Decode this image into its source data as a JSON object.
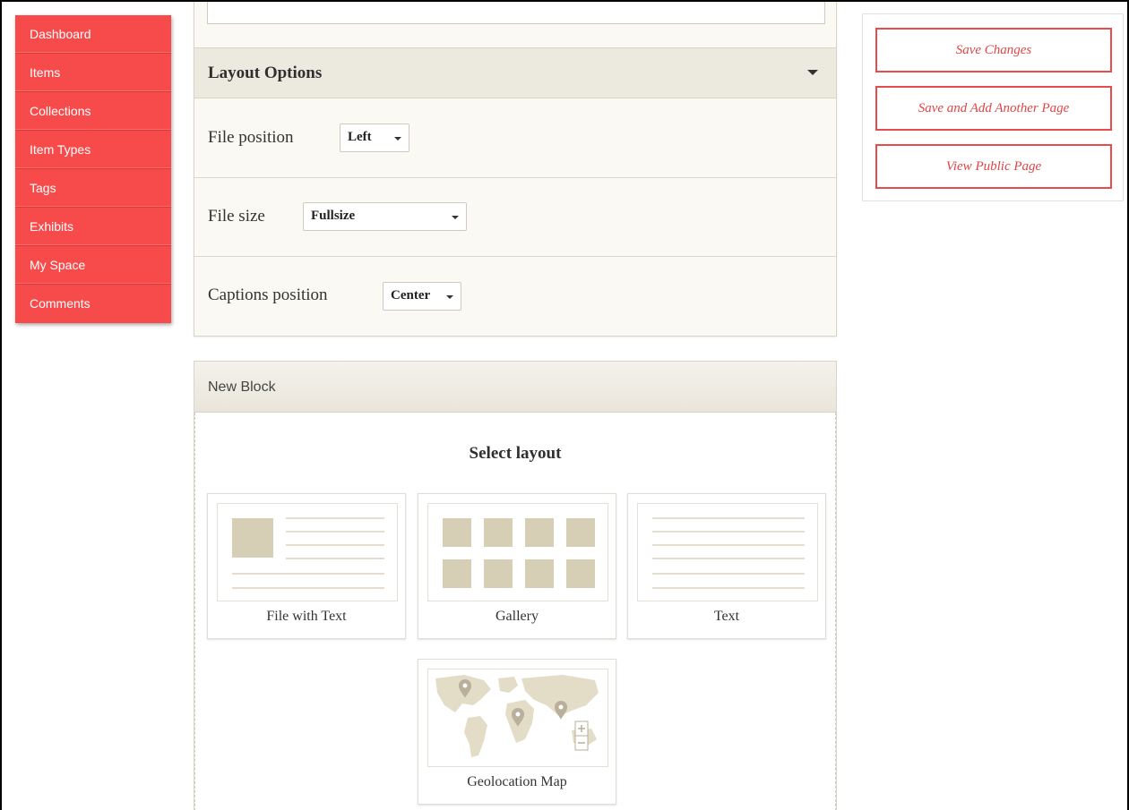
{
  "nav": {
    "items": [
      "Dashboard",
      "Items",
      "Collections",
      "Item Types",
      "Tags",
      "Exhibits",
      "My Space",
      "Comments"
    ]
  },
  "layout_options": {
    "title": "Layout Options",
    "file_position": {
      "label": "File position",
      "value": "Left"
    },
    "file_size": {
      "label": "File size",
      "value": "Fullsize"
    },
    "captions_position": {
      "label": "Captions position",
      "value": "Center"
    }
  },
  "new_block": {
    "header": "New Block",
    "select_layout": "Select layout",
    "layouts": [
      "File with Text",
      "Gallery",
      "Text",
      "Geolocation Map"
    ]
  },
  "actions": {
    "save": "Save Changes",
    "save_add": "Save and Add Another Page",
    "view_public": "View Public Page"
  },
  "colors": {
    "accent": "#f74b4b",
    "panel_bg": "#faf9f4",
    "thumb_fill": "#d7ceb6"
  }
}
